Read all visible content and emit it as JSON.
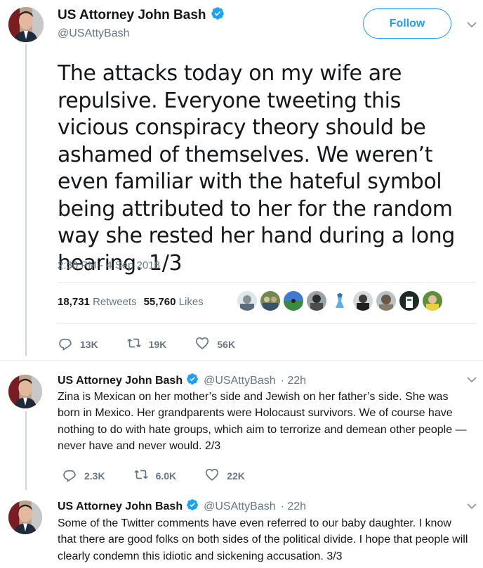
{
  "main_tweet": {
    "author_name": "US Attorney John Bash",
    "author_handle": "@USAttyBash",
    "follow_label": "Follow",
    "text": "The attacks today on my wife are repulsive. Everyone tweeting this vicious conspiracy theory should be ashamed of themselves. We weren’t even familiar with the hateful symbol being attributed to her for the random way she rested her hand during a long hearing. 1/3",
    "timestamp": "2:36 PM - 4 Sep 2018",
    "retweets_count": "18,731",
    "retweets_label": "Retweets",
    "likes_count": "55,760",
    "likes_label": "Likes",
    "actions": {
      "reply": "13K",
      "retweet": "19K",
      "like": "56K"
    }
  },
  "replies": [
    {
      "author_name": "US Attorney John Bash",
      "author_handle": "@USAttyBash",
      "age": "· 22h",
      "text": "Zina is Mexican on her mother’s side and Jewish on her father’s side. She was born in Mexico. Her grandparents were Holocaust survivors. We of course have nothing to do with hate groups, which aim to terrorize and demean other people — never have and never would. 2/3",
      "actions": {
        "reply": "2.3K",
        "retweet": "6.0K",
        "like": "22K"
      }
    },
    {
      "author_name": "US Attorney John Bash",
      "author_handle": "@USAttyBash",
      "age": "· 22h",
      "text": "Some of the Twitter comments have even referred to our baby daughter. I know that there are good folks on both sides of the political divide. I hope that people will clearly condemn this idiotic and sickening accusation. 3/3"
    }
  ],
  "icons": {
    "verified": "verified-badge-icon",
    "caret": "chevron-down-icon",
    "reply": "reply-icon",
    "retweet": "retweet-icon",
    "like": "heart-icon"
  },
  "colors": {
    "accent": "#1da1f2",
    "muted": "#657786",
    "text": "#14171a"
  }
}
